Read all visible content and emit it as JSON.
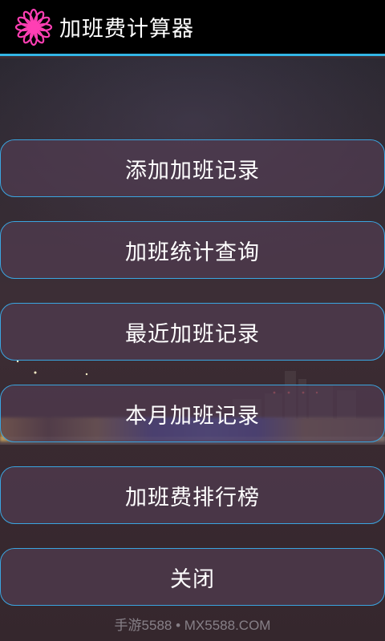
{
  "app": {
    "title": "加班费计算器",
    "icon": "pink-flower-icon",
    "accent": "#33b5e5"
  },
  "menu": [
    {
      "label": "添加加班记录"
    },
    {
      "label": "加班统计查询"
    },
    {
      "label": "最近加班记录"
    },
    {
      "label": "本月加班记录"
    },
    {
      "label": "加班费排行榜"
    },
    {
      "label": "关闭"
    }
  ],
  "watermark": "手游5588 • MX5588.COM"
}
